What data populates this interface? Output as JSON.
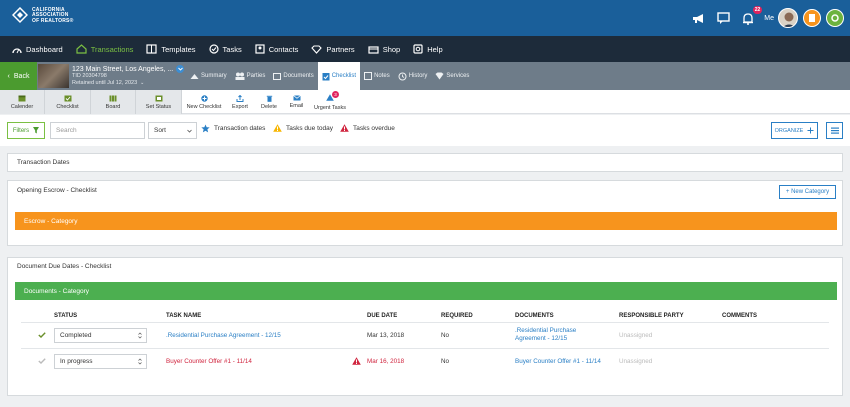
{
  "brand": {
    "line1": "CALIFORNIA",
    "line2": "ASSOCIATION",
    "line3": "OF REALTORS®"
  },
  "header": {
    "notification_count": "22",
    "me_label": "Me"
  },
  "nav": [
    {
      "label": "Dashboard",
      "icon": "dashboard-icon"
    },
    {
      "label": "Transactions",
      "icon": "home-icon",
      "active": true
    },
    {
      "label": "Templates",
      "icon": "templates-icon"
    },
    {
      "label": "Tasks",
      "icon": "tasks-icon"
    },
    {
      "label": "Contacts",
      "icon": "contacts-icon"
    },
    {
      "label": "Partners",
      "icon": "partners-icon"
    },
    {
      "label": "Shop",
      "icon": "shop-icon"
    },
    {
      "label": "Help",
      "icon": "help-icon"
    }
  ],
  "transaction": {
    "back_label": "Back",
    "address": "123 Main Street, Los Angeles, ...",
    "tid": "TID 20304798",
    "retained": "Retained until Jul 12, 2023"
  },
  "subtabs": [
    {
      "label": "Summary"
    },
    {
      "label": "Parties"
    },
    {
      "label": "Documents"
    },
    {
      "label": "Checklist",
      "active": true
    },
    {
      "label": "Notes"
    },
    {
      "label": "History"
    },
    {
      "label": "Services"
    }
  ],
  "toolbar": {
    "views": [
      "Calender",
      "Checklist",
      "Board",
      "Set Status"
    ],
    "actions": [
      "New Checklist",
      "Export",
      "Delete",
      "Email",
      "Urgent Tasks"
    ],
    "urgent_count": "3"
  },
  "filters": {
    "filters_label": "Filters",
    "search_placeholder": "Search",
    "sort_value": "Sort",
    "legend": [
      "Transaction dates",
      "Tasks due today",
      "Tasks overdue"
    ],
    "organize_label": "ORGANIZE"
  },
  "sections": {
    "transaction_dates": "Transaction Dates",
    "opening_escrow": "Opening Escrow - Checklist",
    "new_category": "+ New Category",
    "escrow_category": "Escrow - Category",
    "doc_due_dates": "Document Due Dates - Checklist",
    "documents_category": "Documents - Category"
  },
  "colors": {
    "escrow": "#f7941d",
    "documents": "#4caf50",
    "accent": "#2a7fc5",
    "overdue": "#d0243e"
  },
  "table": {
    "headers": [
      "STATUS",
      "TASK NAME",
      "DUE DATE",
      "REQUIRED",
      "DOCUMENTS",
      "RESPONSIBLE PARTY",
      "COMMENTS"
    ],
    "rows": [
      {
        "status": "Completed",
        "task": ".Residential Purchase Agreement - 12/15",
        "due": "Mar 13, 2018",
        "required": "No",
        "doc_line1": ".Residential Purchase",
        "doc_line2": "Agreement - 12/15",
        "party": "Unassigned",
        "overdue": false
      },
      {
        "status": "In progress",
        "task": "Buyer Counter Offer #1 - 11/14",
        "due": "Mar 16, 2018",
        "required": "No",
        "doc_line1": "Buyer Counter Offer #1 - 11/14",
        "doc_line2": "",
        "party": "Unassigned",
        "overdue": true
      }
    ]
  }
}
